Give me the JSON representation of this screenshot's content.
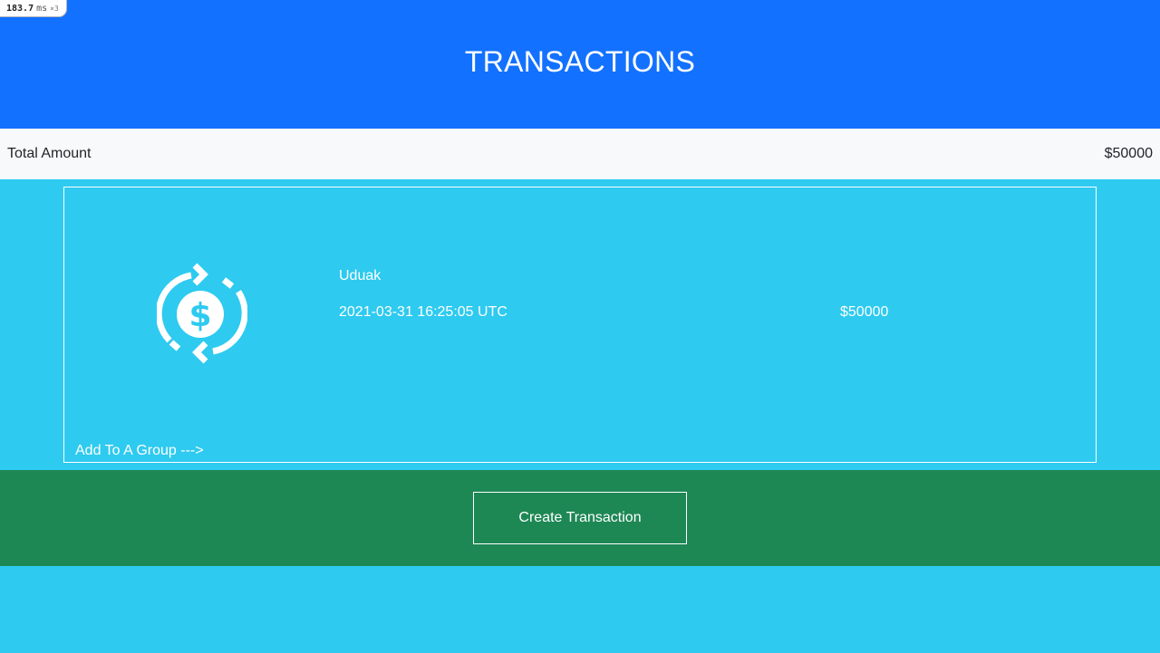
{
  "perf_badge": {
    "value": "183.7",
    "unit": "ms",
    "multiplier": "×3"
  },
  "header": {
    "title": "TRANSACTIONS"
  },
  "summary": {
    "total_label": "Total Amount",
    "total_value": "$50000"
  },
  "transactions": [
    {
      "icon": "dollar-refresh-icon",
      "name": "Uduak",
      "date": "2021-03-31 16:25:05 UTC",
      "amount": "$50000",
      "group_link": "Add To A Group --->"
    }
  ],
  "footer": {
    "create_label": "Create Transaction"
  },
  "colors": {
    "header_bg": "#1371ff",
    "page_bg": "#2ecaf0",
    "summary_bg": "#f8f9fa",
    "footer_bg": "#1e8855",
    "text_light": "#ffffff",
    "text_dark": "#212529"
  }
}
